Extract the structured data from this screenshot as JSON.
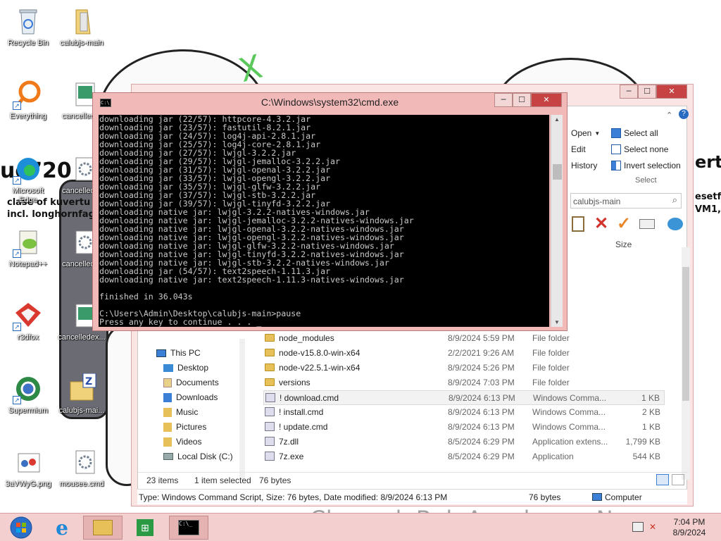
{
  "wallpaper": {
    "text_left_1": "uc720",
    "text_left_2": "clase of kuvertu",
    "text_left_3": "incl. longhornfag",
    "text_right_1": "ertu",
    "text_right_2": "esetfc",
    "text_right_3": "VM1,",
    "watermark": "CherrydoBoloAconha on Newgrounds."
  },
  "desktop": {
    "icons": [
      {
        "label": "Recycle Bin",
        "icon": "recycle-bin-icon"
      },
      {
        "label": "calubjs-main",
        "icon": "folder-icon"
      },
      {
        "label": "Everything",
        "icon": "search-app-icon"
      },
      {
        "label": "cancelled...",
        "icon": "image-file-icon"
      },
      {
        "label": "Microsoft Edge",
        "icon": "edge-icon"
      },
      {
        "label": "cancelled...",
        "icon": "settings-file-icon"
      },
      {
        "label": "Notepad++",
        "icon": "notepadpp-icon"
      },
      {
        "label": "cancelled...",
        "icon": "settings-file-icon"
      },
      {
        "label": "r3dfox",
        "icon": "r3dfox-icon"
      },
      {
        "label": "cancelledex...",
        "icon": "image-file-icon"
      },
      {
        "label": "Supermium",
        "icon": "supermium-icon"
      },
      {
        "label": "calubjs-mai...",
        "icon": "zip-folder-icon"
      },
      {
        "label": "3aVWyG.png",
        "icon": "png-file-icon"
      },
      {
        "label": "mousee.cmd",
        "icon": "settings-file-icon"
      }
    ]
  },
  "cmd": {
    "title": "C:\\Windows\\system32\\cmd.exe",
    "lines": [
      "downloading jar (22/57): httpcore-4.3.2.jar",
      "downloading jar (23/57): fastutil-8.2.1.jar",
      "downloading jar (24/57): log4j-api-2.8.1.jar",
      "downloading jar (25/57): log4j-core-2.8.1.jar",
      "downloading jar (27/57): lwjgl-3.2.2.jar",
      "downloading jar (29/57): lwjgl-jemalloc-3.2.2.jar",
      "downloading jar (31/57): lwjgl-openal-3.2.2.jar",
      "downloading jar (33/57): lwjgl-opengl-3.2.2.jar",
      "downloading jar (35/57): lwjgl-glfw-3.2.2.jar",
      "downloading jar (37/57): lwjgl-stb-3.2.2.jar",
      "downloading jar (39/57): lwjgl-tinyfd-3.2.2.jar",
      "downloading native jar: lwjgl-3.2.2-natives-windows.jar",
      "downloading native jar: lwjgl-jemalloc-3.2.2-natives-windows.jar",
      "downloading native jar: lwjgl-openal-3.2.2-natives-windows.jar",
      "downloading native jar: lwjgl-opengl-3.2.2-natives-windows.jar",
      "downloading native jar: lwjgl-glfw-3.2.2-natives-windows.jar",
      "downloading native jar: lwjgl-tinyfd-3.2.2-natives-windows.jar",
      "downloading native jar: lwjgl-stb-3.2.2-natives-windows.jar",
      "downloading jar (54/57): text2speech-1.11.3.jar",
      "downloading native jar: text2speech-1.11.3-natives-windows.jar",
      "",
      "finished in 36.043s",
      "",
      "C:\\Users\\Admin\\Desktop\\calubjs-main>pause",
      "Press any key to continue . . . _"
    ],
    "controls": {
      "minimize": "─",
      "maximize": "☐",
      "close": "✕"
    }
  },
  "explorer": {
    "ribbon": {
      "open": "Open",
      "edit": "Edit",
      "history": "History",
      "select_all": "Select all",
      "select_none": "Select none",
      "invert_selection": "Invert selection",
      "group_select": "Select"
    },
    "search_placeholder": "calubjs-main",
    "column_size": "Size",
    "nav": [
      {
        "label": "This PC",
        "icon": "computer-icon"
      },
      {
        "label": "Desktop",
        "icon": "desktop-icon"
      },
      {
        "label": "Documents",
        "icon": "documents-icon"
      },
      {
        "label": "Downloads",
        "icon": "downloads-icon"
      },
      {
        "label": "Music",
        "icon": "music-icon"
      },
      {
        "label": "Pictures",
        "icon": "pictures-icon"
      },
      {
        "label": "Videos",
        "icon": "videos-icon"
      },
      {
        "label": "Local Disk (C:)",
        "icon": "disk-icon"
      }
    ],
    "files": [
      {
        "name": "node_modules",
        "date": "8/9/2024 5:59 PM",
        "type": "File folder",
        "size": "",
        "kind": "folder"
      },
      {
        "name": "node-v15.8.0-win-x64",
        "date": "2/2/2021 9:26 AM",
        "type": "File folder",
        "size": "",
        "kind": "folder"
      },
      {
        "name": "node-v22.5.1-win-x64",
        "date": "8/9/2024 5:26 PM",
        "type": "File folder",
        "size": "",
        "kind": "folder"
      },
      {
        "name": "versions",
        "date": "8/9/2024 7:03 PM",
        "type": "File folder",
        "size": "",
        "kind": "folder"
      },
      {
        "name": "! download.cmd",
        "date": "8/9/2024 6:13 PM",
        "type": "Windows Comma...",
        "size": "1 KB",
        "kind": "cmd"
      },
      {
        "name": "! install.cmd",
        "date": "8/9/2024 6:13 PM",
        "type": "Windows Comma...",
        "size": "2 KB",
        "kind": "cmd"
      },
      {
        "name": "! update.cmd",
        "date": "8/9/2024 6:13 PM",
        "type": "Windows Comma...",
        "size": "1 KB",
        "kind": "cmd"
      },
      {
        "name": "7z.dll",
        "date": "8/5/2024 6:29 PM",
        "type": "Application extens...",
        "size": "1,799 KB",
        "kind": "dll"
      },
      {
        "name": "7z.exe",
        "date": "8/5/2024 6:29 PM",
        "type": "Application",
        "size": "544 KB",
        "kind": "exe"
      }
    ],
    "status": {
      "items": "23 items",
      "selected": "1 item selected",
      "selected_size": "76 bytes"
    },
    "details_bar": {
      "text": "Type: Windows Command Script, Size: 76 bytes, Date modified: 8/9/2024 6:13 PM",
      "size": "76 bytes",
      "location": "Computer"
    }
  },
  "taskbar": {
    "time": "7:04 PM",
    "date": "8/9/2024"
  }
}
